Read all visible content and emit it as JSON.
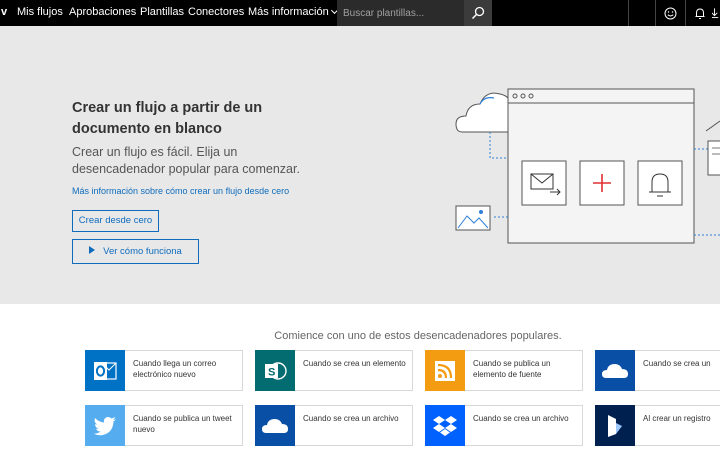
{
  "nav": {
    "logo_fragment": "v",
    "items": [
      {
        "label": "Mis flujos"
      },
      {
        "label": "Aprobaciones"
      },
      {
        "label": "Plantillas"
      },
      {
        "label": "Conectores"
      },
      {
        "label": "Más información"
      }
    ],
    "search_placeholder": "Buscar plantillas...",
    "icons": [
      "search-icon",
      "smiley-icon",
      "bell-icon",
      "download-icon"
    ]
  },
  "hero": {
    "title": "Crear un flujo a partir de un documento en blanco",
    "subtitle": "Crear un flujo es fácil. Elija un desencadenador popular para comenzar.",
    "learn_more_link": "Más información sobre cómo crear un flujo desde cero",
    "create_button": "Crear desde cero",
    "watch_button": "Ver cómo funciona"
  },
  "triggers": {
    "title": "Comience con uno de estos desencadenadores populares.",
    "cards": [
      {
        "label": "Cuando llega un correo electrónico nuevo",
        "icon": "outlook-icon",
        "color": "#0072c6"
      },
      {
        "label": "Cuando se crea un elemento",
        "icon": "sharepoint-icon",
        "color": "#036c70"
      },
      {
        "label": "Cuando se publica un elemento de fuente",
        "icon": "rss-icon",
        "color": "#f39c12"
      },
      {
        "label": "Cuando se crea un",
        "icon": "onedrive-icon",
        "color": "#0a4fa6"
      },
      {
        "label": "Cuando se publica un tweet nuevo",
        "icon": "twitter-icon",
        "color": "#55acee"
      },
      {
        "label": "Cuando se crea un archivo",
        "icon": "onedrive-business-icon",
        "color": "#0a4fa6"
      },
      {
        "label": "Cuando se crea un archivo",
        "icon": "dropbox-icon",
        "color": "#0061fe"
      },
      {
        "label": "Al crear un registro",
        "icon": "dynamics-icon",
        "color": "#002050"
      }
    ]
  },
  "colors": {
    "accent": "#0f6cbd",
    "hero_bg": "#e8e8e8",
    "nav_bg": "#000000"
  }
}
